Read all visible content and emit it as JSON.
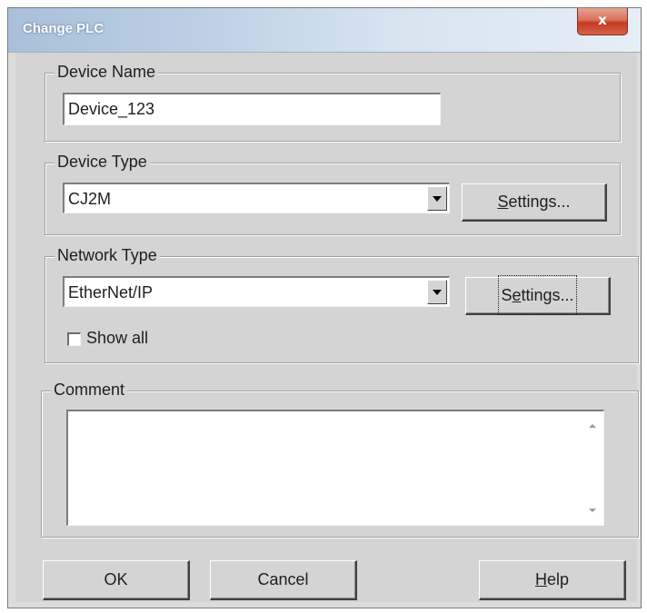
{
  "window": {
    "title": "Change PLC",
    "close_glyph": "x"
  },
  "device_name": {
    "group_label": "Device Name",
    "value": "Device_123"
  },
  "device_type": {
    "group_label": "Device Type",
    "selected": "CJ2M",
    "settings_button": "Settings...",
    "settings_accesskey": "S",
    "settings_rest": "ettings..."
  },
  "network_type": {
    "group_label": "Network Type",
    "selected": "EtherNet/IP",
    "settings_button": "Settings...",
    "settings_pre": "S",
    "settings_accesskey": "e",
    "settings_rest": "ttings...",
    "show_all_label": "Show all",
    "show_all_checked": false
  },
  "comment": {
    "group_label": "Comment",
    "value": ""
  },
  "buttons": {
    "ok": "OK",
    "cancel": "Cancel",
    "help": "Help",
    "help_accesskey": "H",
    "help_rest": "elp"
  },
  "icons": {
    "close": "close-icon",
    "dropdown": "chevron-down-icon",
    "scroll_up": "scroll-up-icon",
    "scroll_down": "scroll-down-icon"
  },
  "colors": {
    "dialog_face": "#d4d4d4",
    "close_button": "#c43a20",
    "titlebar_gradient_start": "#a9c0d8"
  }
}
